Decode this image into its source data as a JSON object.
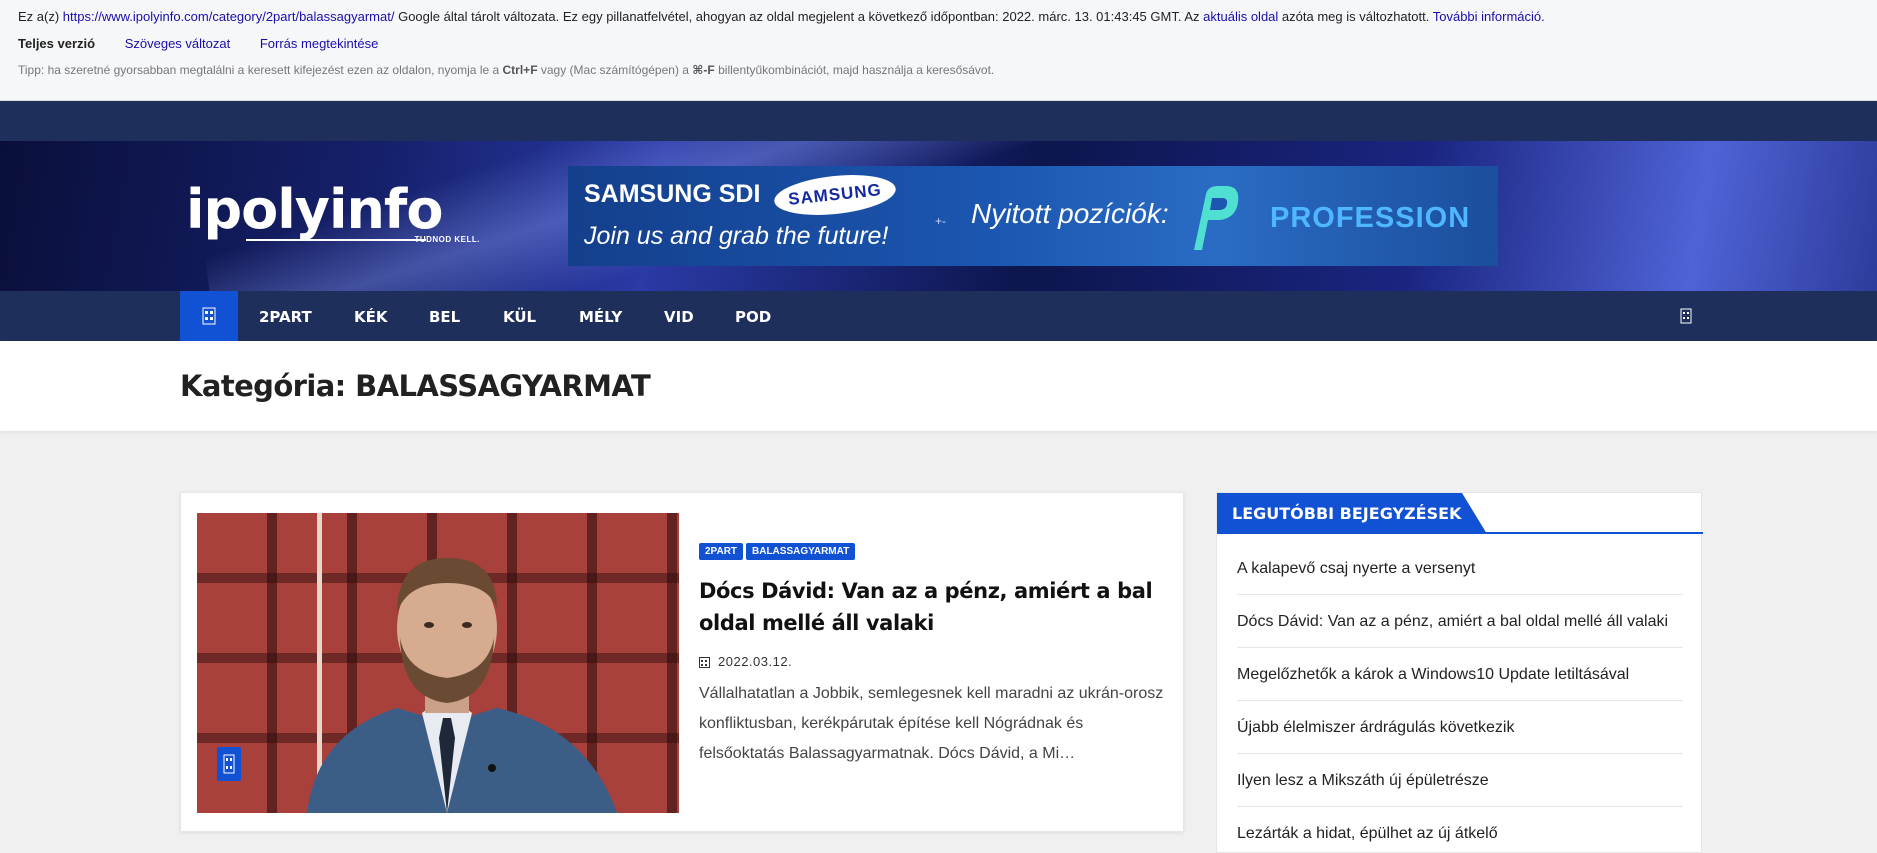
{
  "cache": {
    "prefix": "Ez a(z)",
    "url": "https://www.ipolyinfo.com/category/2part/balassagyarmat/",
    "middle": "Google által tárolt változata. Ez egy pillanatfelvétel, ahogyan az oldal megjelent a következő időpontban: 2022. márc. 13. 01:43:45 GMT. Az",
    "current_link": "aktuális oldal",
    "after": "azóta meg is változhatott.",
    "more_link": "További információ.",
    "full_version": "Teljes verzió",
    "text_version": "Szöveges változat",
    "source_view": "Forrás megtekintése",
    "tip_prefix": "Tipp: ha szeretné gyorsabban megtalálni a keresett kifejezést ezen az oldalon, nyomja le a",
    "tip_key1": "Ctrl+F",
    "tip_middle": "vagy (Mac számítógépen) a",
    "tip_key2": "⌘-F",
    "tip_suffix": "billentyűkombinációt, majd használja a keresősávot."
  },
  "header": {
    "logo_text": "ipolyinfo",
    "logo_tagline": "TUDNOD KELL.",
    "banner": {
      "brand": "SAMSUNG SDI",
      "oval": "SAMSUNG",
      "slogan": "Join us and grab the future!",
      "arrows": "+-",
      "open_positions": "Nyitott pozíciók:",
      "profession": "PROFESSION"
    }
  },
  "nav": {
    "items": [
      "2PART",
      "KÉK",
      "BEL",
      "KÜL",
      "MÉLY",
      "VID",
      "POD"
    ]
  },
  "page": {
    "title": "Kategória: BALASSAGYARMAT"
  },
  "post": {
    "categories": [
      "2PART",
      "BALASSAGYARMAT"
    ],
    "title": "Dócs Dávid: Van az a pénz, amiért a bal oldal mellé áll valaki",
    "date": "2022.03.12.",
    "excerpt": "Vállalhatatlan a Jobbik, semlegesnek kell maradni az ukrán-orosz konfliktusban, kerékpárutak építése kell Nógrádnak és felsőoktatás Balassagyarmatnak. Dócs Dávid, a Mi…"
  },
  "sidebar": {
    "heading": "LEGUTÓBBI BEJEGYZÉSEK",
    "items": [
      "A kalapevő csaj nyerte a versenyt",
      "Dócs Dávid: Van az a pénz, amiért a bal oldal mellé áll valaki",
      "Megelőzhetők a károk a Windows10 Update letiltásával",
      "Újabb élelmiszer árdrágulás következik",
      "Ilyen lesz a Mikszáth új épületrésze",
      "Lezárták a hidat, épülhet az új átkelő"
    ]
  },
  "colors": {
    "accent": "#1151d3",
    "nav_bg": "#1f2f5c"
  },
  "icons": {
    "home": "home-icon",
    "search": "search-icon",
    "calendar": "calendar-icon",
    "format": "post-format-icon"
  }
}
